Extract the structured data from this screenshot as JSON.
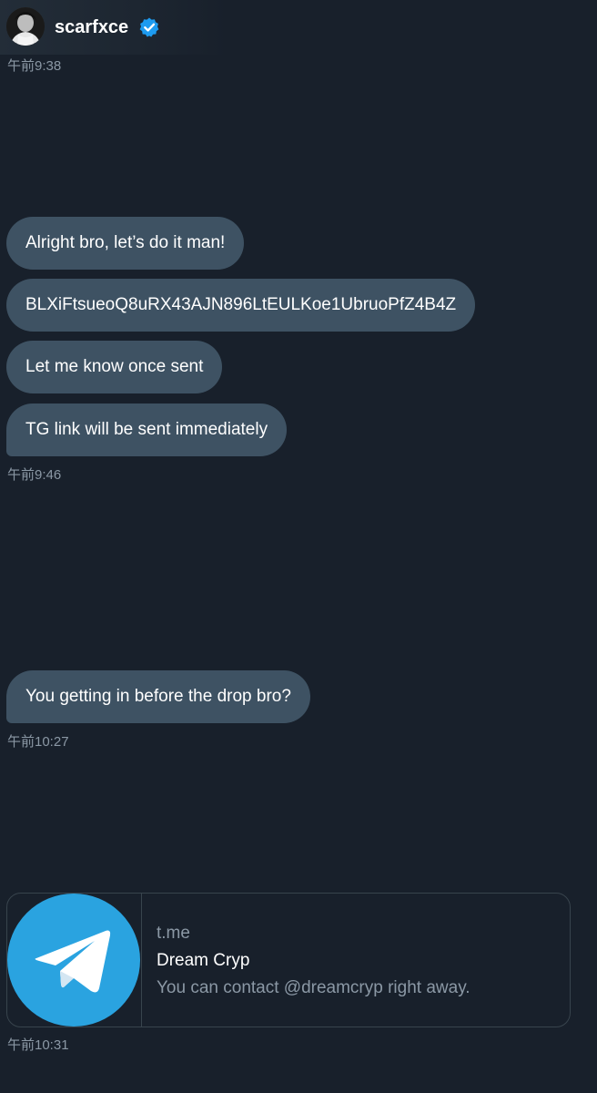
{
  "header": {
    "username": "scarfxce",
    "verified": true,
    "avatar_icon": "profile-photo",
    "badge_icon": "verified-badge-icon",
    "badge_color": "#1d9bf0"
  },
  "messages": [
    {
      "timestamp": "午前9:38"
    },
    {
      "bubbles": [
        "Alright bro, let’s do it man!",
        "BLXiFtsueoQ8uRX43AJN896LtEULKoe1UbruoPfZ4B4Z",
        "Let me know once sent",
        "TG link will be sent immediately"
      ],
      "timestamp": "午前9:46"
    },
    {
      "bubbles": [
        "You getting in before the drop bro?"
      ],
      "timestamp": "午前10:27"
    },
    {
      "card": {
        "icon": "telegram-logo-icon",
        "icon_color": "#2aa3e0",
        "domain": "t.me",
        "title": "Dream Cryp",
        "description": "You can contact @dreamcryp right away."
      },
      "timestamp": "午前10:31"
    }
  ],
  "colors": {
    "background": "#18202b",
    "bubble": "#3e5263",
    "muted_text": "#8b98a5",
    "border": "#38444d"
  }
}
